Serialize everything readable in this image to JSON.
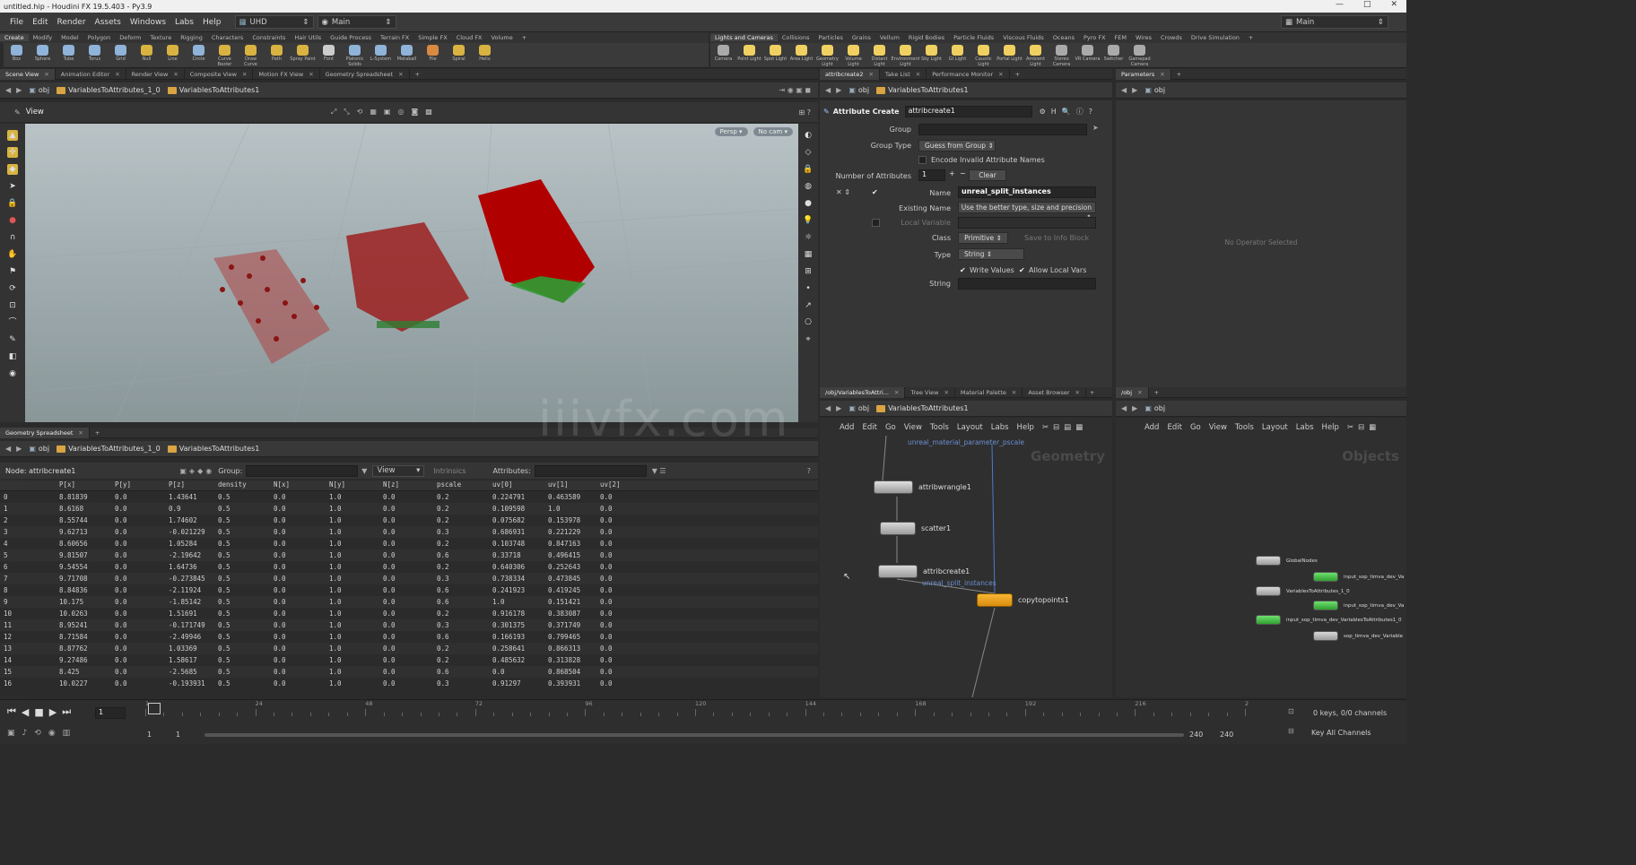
{
  "window": {
    "title": "untitled.hip - Houdini FX 19.5.403 - Py3.9",
    "controls": [
      "—",
      "□",
      "✕"
    ]
  },
  "menubar": {
    "items": [
      "File",
      "Edit",
      "Render",
      "Assets",
      "Windows",
      "Labs",
      "Help"
    ],
    "desktop": "UHD",
    "desktop2": "Main",
    "right_desktop": "Main"
  },
  "shelf": {
    "tabs": [
      "Create",
      "Modify",
      "Model",
      "Polygon",
      "Deform",
      "Texture",
      "Rigging",
      "Characters",
      "Constraints",
      "Hair Utils",
      "Guide Process",
      "Terrain FX",
      "Simple FX",
      "Cloud FX",
      "Volume"
    ],
    "tools": [
      {
        "l": "Box",
        "c": "#8fb3d9"
      },
      {
        "l": "Sphere",
        "c": "#8fb3d9"
      },
      {
        "l": "Tube",
        "c": "#8fb3d9"
      },
      {
        "l": "Torus",
        "c": "#8fb3d9"
      },
      {
        "l": "Grid",
        "c": "#8fb3d9"
      },
      {
        "l": "Null",
        "c": "#d9b341"
      },
      {
        "l": "Line",
        "c": "#d9b341"
      },
      {
        "l": "Circle",
        "c": "#8fb3d9"
      },
      {
        "l": "Curve Bezier",
        "c": "#d9b341"
      },
      {
        "l": "Draw Curve",
        "c": "#d9b341"
      },
      {
        "l": "Path",
        "c": "#d9b341"
      },
      {
        "l": "Spray Paint",
        "c": "#d9b341"
      },
      {
        "l": "Font",
        "c": "#ccc"
      },
      {
        "l": "Platonic Solids",
        "c": "#8fb3d9"
      },
      {
        "l": "L-System",
        "c": "#8fb3d9"
      },
      {
        "l": "Metaball",
        "c": "#8fb3d9"
      },
      {
        "l": "File",
        "c": "#d98a41"
      },
      {
        "l": "Spiral",
        "c": "#d9b341"
      },
      {
        "l": "Helix",
        "c": "#d9b341"
      }
    ],
    "tabs2": [
      "Lights and Cameras",
      "Collisions",
      "Particles",
      "Grains",
      "Vellum",
      "Rigid Bodies",
      "Particle Fluids",
      "Viscous Fluids",
      "Oceans",
      "Pyro FX",
      "FEM",
      "Wires",
      "Crowds",
      "Drive Simulation"
    ],
    "tools2": [
      {
        "l": "Camera",
        "c": "#aaa"
      },
      {
        "l": "Point Light",
        "c": "#f0d060"
      },
      {
        "l": "Spot Light",
        "c": "#f0d060"
      },
      {
        "l": "Area Light",
        "c": "#f0d060"
      },
      {
        "l": "Geometry Light",
        "c": "#f0d060"
      },
      {
        "l": "Volume Light",
        "c": "#f0d060"
      },
      {
        "l": "Distant Light",
        "c": "#f0d060"
      },
      {
        "l": "Environment Light",
        "c": "#f0d060"
      },
      {
        "l": "Sky Light",
        "c": "#f0d060"
      },
      {
        "l": "GI Light",
        "c": "#f0d060"
      },
      {
        "l": "Caustic Light",
        "c": "#f0d060"
      },
      {
        "l": "Portal Light",
        "c": "#f0d060"
      },
      {
        "l": "Ambient Light",
        "c": "#f0d060"
      },
      {
        "l": "Stereo Camera",
        "c": "#aaa"
      },
      {
        "l": "VR Camera",
        "c": "#aaa"
      },
      {
        "l": "Switcher",
        "c": "#aaa"
      },
      {
        "l": "Gamepad Camera",
        "c": "#aaa"
      }
    ]
  },
  "scene": {
    "tabs": [
      "Scene View",
      "Animation Editor",
      "Render View",
      "Composite View",
      "Motion FX View",
      "Geometry Spreadsheet"
    ],
    "path_obj": "obj",
    "path1": "VariablesToAttributes_1_0",
    "path2": "VariablesToAttributes1",
    "view_label": "View",
    "persp": "Persp",
    "nocam": "No cam"
  },
  "spreadsheet": {
    "tab": "Geometry Spreadsheet",
    "path_obj": "obj",
    "path1": "VariablesToAttributes_1_0",
    "path2": "VariablesToAttributes1",
    "node_label": "Node: attribcreate1",
    "group_label": "Group:",
    "view_label": "View",
    "intrinsics": "Intrinsics",
    "attributes_label": "Attributes:",
    "columns": [
      "",
      "P[x]",
      "P[y]",
      "P[z]",
      "density",
      "N[x]",
      "N[y]",
      "N[z]",
      "pscale",
      "uv[0]",
      "uv[1]",
      "uv[2]"
    ],
    "rows": [
      [
        "0",
        "8.81839",
        "0.0",
        "1.43641",
        "0.5",
        "0.0",
        "1.0",
        "0.0",
        "0.2",
        "0.224791",
        "0.463589",
        "0.0"
      ],
      [
        "1",
        "8.6168",
        "0.0",
        "0.9",
        "0.5",
        "0.0",
        "1.0",
        "0.0",
        "0.2",
        "0.109598",
        "1.0",
        "0.0"
      ],
      [
        "2",
        "8.55744",
        "0.0",
        "1.74602",
        "0.5",
        "0.0",
        "1.0",
        "0.0",
        "0.2",
        "0.075682",
        "0.153978",
        "0.0"
      ],
      [
        "3",
        "9.62713",
        "0.0",
        "-0.021229",
        "0.5",
        "0.0",
        "1.0",
        "0.0",
        "0.3",
        "0.686931",
        "0.221229",
        "0.0"
      ],
      [
        "4",
        "8.60656",
        "0.0",
        "1.05284",
        "0.5",
        "0.0",
        "1.0",
        "0.0",
        "0.2",
        "0.103748",
        "0.847163",
        "0.0"
      ],
      [
        "5",
        "9.81507",
        "0.0",
        "-2.19642",
        "0.5",
        "0.0",
        "1.0",
        "0.0",
        "0.6",
        "0.33718",
        "0.496415",
        "0.0"
      ],
      [
        "6",
        "9.54554",
        "0.0",
        "1.64736",
        "0.5",
        "0.0",
        "1.0",
        "0.0",
        "0.2",
        "0.640306",
        "0.252643",
        "0.0"
      ],
      [
        "7",
        "9.71708",
        "0.0",
        "-0.273845",
        "0.5",
        "0.0",
        "1.0",
        "0.0",
        "0.3",
        "0.738334",
        "0.473845",
        "0.0"
      ],
      [
        "8",
        "8.84836",
        "0.0",
        "-2.11924",
        "0.5",
        "0.0",
        "1.0",
        "0.0",
        "0.6",
        "0.241923",
        "0.419245",
        "0.0"
      ],
      [
        "9",
        "10.175",
        "0.0",
        "-1.85142",
        "0.5",
        "0.0",
        "1.0",
        "0.0",
        "0.6",
        "1.0",
        "0.151421",
        "0.0"
      ],
      [
        "10",
        "10.0263",
        "0.0",
        "1.51691",
        "0.5",
        "0.0",
        "1.0",
        "0.0",
        "0.2",
        "0.916178",
        "0.383087",
        "0.0"
      ],
      [
        "11",
        "8.95241",
        "0.0",
        "-0.171749",
        "0.5",
        "0.0",
        "1.0",
        "0.0",
        "0.3",
        "0.301375",
        "0.371749",
        "0.0"
      ],
      [
        "12",
        "8.71584",
        "0.0",
        "-2.49946",
        "0.5",
        "0.0",
        "1.0",
        "0.0",
        "0.6",
        "0.166193",
        "0.799465",
        "0.0"
      ],
      [
        "13",
        "8.87762",
        "0.0",
        "1.03369",
        "0.5",
        "0.0",
        "1.0",
        "0.0",
        "0.2",
        "0.258641",
        "0.866313",
        "0.0"
      ],
      [
        "14",
        "9.27486",
        "0.0",
        "1.58617",
        "0.5",
        "0.0",
        "1.0",
        "0.0",
        "0.2",
        "0.485632",
        "0.313828",
        "0.0"
      ],
      [
        "15",
        "8.425",
        "0.0",
        "-2.5685",
        "0.5",
        "0.0",
        "1.0",
        "0.0",
        "0.6",
        "0.0",
        "0.868504",
        "0.0"
      ],
      [
        "16",
        "10.0227",
        "0.0",
        "-0.193931",
        "0.5",
        "0.0",
        "1.0",
        "0.0",
        "0.3",
        "0.91297",
        "0.393931",
        "0.0"
      ]
    ]
  },
  "params": {
    "tabs": [
      "attribcreate2",
      "Take List",
      "Performance Monitor"
    ],
    "path_obj": "obj",
    "path2": "VariablesToAttributes1",
    "node_type": "Attribute Create",
    "node_name": "attribcreate1",
    "group_label": "Group",
    "group_type_label": "Group Type",
    "group_type": "Guess from Group",
    "encode_label": "Encode Invalid Attribute Names",
    "num_attr_label": "Number of Attributes",
    "num_attr": "1",
    "clear": "Clear",
    "name_label": "Name",
    "name_value": "unreal_split_instances",
    "existing_label": "Existing Name",
    "existing_value": "Use the better type, size and precision",
    "local_var_label": "Local Variable",
    "class_label": "Class",
    "class_value": "Primitive",
    "save_info": "Save to Info Block",
    "type_label": "Type",
    "type_value": "String",
    "write_values": "Write Values",
    "allow_local": "Allow Local Vars",
    "string_label": "String"
  },
  "parameters2": {
    "tab": "Parameters",
    "path_obj": "obj",
    "empty": "No Operator Selected"
  },
  "network": {
    "tabs": [
      "/obj/VariablesToAttri...",
      "Tree View",
      "Material Palette",
      "Asset Browser"
    ],
    "path_obj": "obj",
    "path2": "VariablesToAttributes1",
    "menu": [
      "Add",
      "Edit",
      "Go",
      "View",
      "Tools",
      "Layout",
      "Labs",
      "Help"
    ],
    "context": "Geometry",
    "top_label": "unreal_material_parameter_pscale",
    "nodes": [
      "attribwrangle1",
      "scatter1",
      "attribcreate1",
      "copytopoints1"
    ],
    "attrib_note": "unreal_split_instances"
  },
  "network2": {
    "tab": "/obj",
    "path_obj": "obj",
    "menu": [
      "Add",
      "Edit",
      "Go",
      "View",
      "Tools",
      "Layout",
      "Labs",
      "Help"
    ],
    "context": "Objects",
    "nodes": [
      "GlobalNodes",
      "input_sop_timva_dev_Va",
      "VariablesToAttributes_1_0",
      "input_sop_timva_dev_Va",
      "input_sop_timva_dev_VariablesToAttributes1_0",
      "sop_timva_dev_Variable"
    ]
  },
  "timeline": {
    "frame": "1",
    "ticks": [
      "1",
      "24",
      "48",
      "72",
      "96",
      "120",
      "144",
      "168",
      "192",
      "216",
      "2"
    ],
    "start": "1",
    "start2": "1",
    "end": "240",
    "end2": "240",
    "keys": "0 keys, 0/0 channels",
    "key_all": "Key All Channels"
  },
  "watermark": "iiivfx.com"
}
